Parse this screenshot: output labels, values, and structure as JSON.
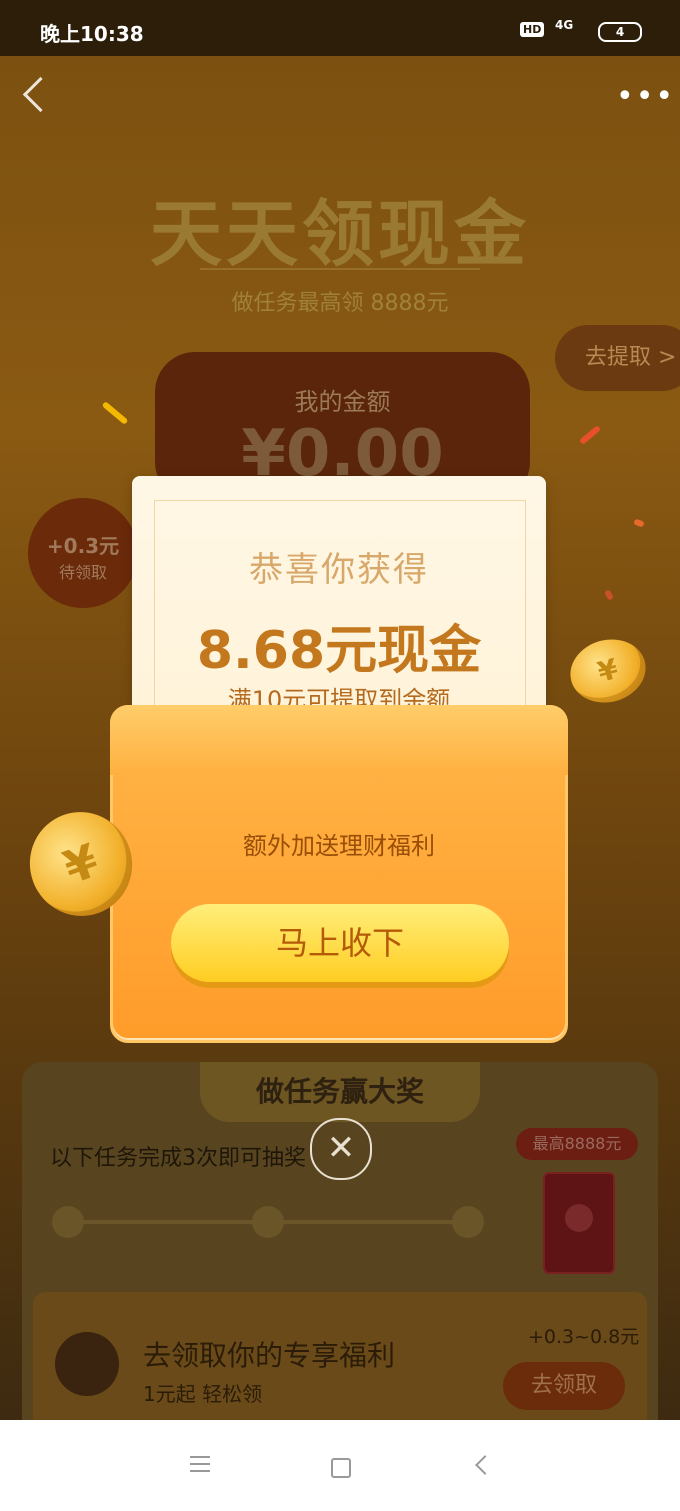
{
  "status_bar": {
    "time": "晚上10:38",
    "hd": "HD",
    "network": "4G",
    "battery": "4"
  },
  "header": {
    "title": "天天领现金",
    "subtitle": "做任务最高领 8888元",
    "withdraw_label": "去提取 >"
  },
  "balance": {
    "label": "我的金额",
    "amount": "¥0.00"
  },
  "pending_bubble": {
    "amount": "+0.3元",
    "label": "待领取"
  },
  "popup": {
    "congrats": "恭喜你获得",
    "prize": "8.68元现金",
    "note": "满10元可提取到余额",
    "extra": "额外加送理财福利",
    "accept_label": "马上收下",
    "close_symbol": "✕"
  },
  "tasks": {
    "tab_title": "做任务赢大奖",
    "description": "以下任务完成3次即可抽奖",
    "max_badge": "最高8888元"
  },
  "benefit": {
    "title": "去领取你的专享福利",
    "subtitle": "1元起 轻松领",
    "reward": "+0.3~0.8元",
    "button_label": "去领取"
  },
  "colors": {
    "accent": "#ffb648",
    "prize_text": "#c4781e",
    "button": "#ffcd22"
  }
}
